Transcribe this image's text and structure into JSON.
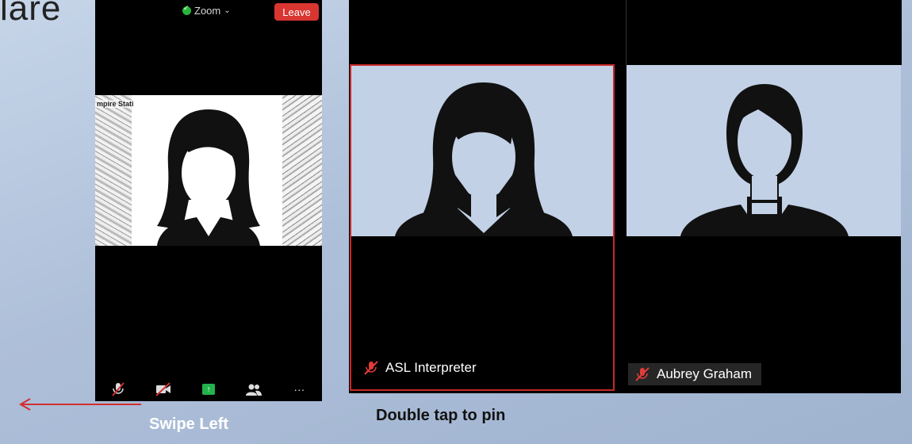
{
  "page": {
    "corner_text": "lare",
    "swipe_label": "Swipe Left",
    "pin_label": "Double tap to pin",
    "arrow_color": "#d32f2f"
  },
  "phone": {
    "meeting_menu_label": "Zoom",
    "leave_label": "Leave",
    "leave_color": "#d93531",
    "background_caption": "mpire Stati",
    "toolbar": [
      {
        "icon": "muted-microphone-icon"
      },
      {
        "icon": "video-off-icon"
      },
      {
        "icon": "share-screen-icon"
      },
      {
        "icon": "participants-icon"
      },
      {
        "icon": "more-icon",
        "glyph": "···"
      }
    ]
  },
  "gallery": {
    "active_border_color": "#c62828",
    "tiles": [
      {
        "name": "ASL Interpreter",
        "muted": true,
        "active": true
      },
      {
        "name": "Aubrey Graham",
        "muted": true,
        "active": false
      }
    ]
  }
}
